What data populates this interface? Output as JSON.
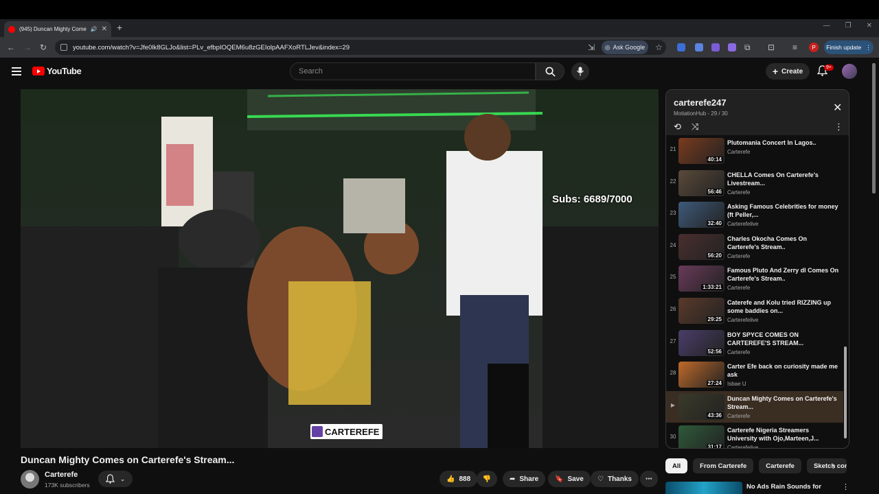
{
  "browser": {
    "tab_title": "(945) Duncan Mighty Come",
    "url": "youtube.com/watch?v=Jfe0lk8GLJo&list=PLv_efbpIOQEM6u8zGEIolpAAFXoRTLJev&index=29",
    "ask_google": "Ask Google",
    "profile_letter": "P",
    "finish_update": "Finish update"
  },
  "header": {
    "logo_text": "YouTube",
    "search_placeholder": "Search",
    "create_label": "Create",
    "notif_count": "9+"
  },
  "video": {
    "subs_overlay": "Subs: 6689/7000",
    "watermark": "CARTEREFE",
    "title": "Duncan Mighty Comes on Carterefe's Stream...",
    "channel_name": "Carterefe",
    "channel_subs": "173K subscribers",
    "like_count": "888",
    "share_label": "Share",
    "save_label": "Save",
    "thanks_label": "Thanks"
  },
  "playlist": {
    "title": "carterefe247",
    "subtitle": "MotiationHub - 29 / 30",
    "items": [
      {
        "index": "21",
        "title": "Plutomania Concert In Lagos..",
        "channel": "Carterefe",
        "duration": "40:14",
        "color": "#7a3b1e"
      },
      {
        "index": "22",
        "title": "CHELLA Comes On Carterefe's Livestream...",
        "channel": "Carterefe",
        "duration": "56:46",
        "color": "#5a4a3a"
      },
      {
        "index": "23",
        "title": "Asking Famous Celebrities for money (ft Peller,...",
        "channel": "Carterefelive",
        "duration": "32:40",
        "color": "#3e5a7a"
      },
      {
        "index": "24",
        "title": "Charles Okocha Comes On Carterefe's Stream..",
        "channel": "Carterefe",
        "duration": "56:20",
        "color": "#4a2e2e"
      },
      {
        "index": "25",
        "title": "Famous Pluto And Zerry dl Comes On Carterefe's Stream..",
        "channel": "Carterefe",
        "duration": "1:33:21",
        "color": "#6a3a5a"
      },
      {
        "index": "26",
        "title": "Caterefe and Kolu tried RIZZING up some baddies on...",
        "channel": "Carterefelive",
        "duration": "29:25",
        "color": "#5a3a2a"
      },
      {
        "index": "27",
        "title": "BOY SPYCE COMES ON CARTEREFE'S STREAM...",
        "channel": "Carterefe",
        "duration": "52:56",
        "color": "#4a3e6a"
      },
      {
        "index": "28",
        "title": "Carter Efe back on curiosity made me ask",
        "channel": "Isbae U",
        "duration": "27:24",
        "color": "#c06a2a"
      },
      {
        "index": "▶",
        "title": "Duncan Mighty Comes on Carterefe's Stream...",
        "channel": "Carterefe",
        "duration": "43:36",
        "color": "#3a3a2a"
      },
      {
        "index": "30",
        "title": "Carterefe Nigeria Streamers University with Ojo,Marteen,J...",
        "channel": "Carterefelive",
        "duration": "31:17",
        "color": "#2e5a3a"
      }
    ]
  },
  "chips": [
    "All",
    "From Carterefe",
    "Carterefe",
    "Sketch con"
  ],
  "related": {
    "title": "No Ads Rain Sounds for"
  }
}
